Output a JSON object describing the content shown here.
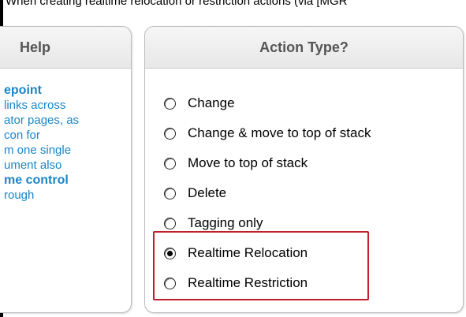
{
  "caption": "When creating realtime relocation or restriction actions  (via [MGR",
  "help_panel": {
    "title": "Help",
    "lines": [
      {
        "text": "epoint",
        "bold": true
      },
      {
        "text": " links across",
        "bold": false
      },
      {
        "text": "ator pages, as",
        "bold": false
      },
      {
        "text": "con for",
        "bold": false
      },
      {
        "text": "m one single",
        "bold": false
      },
      {
        "text": "ument also",
        "bold": false
      },
      {
        "text": "me control",
        "bold": true
      },
      {
        "text": "rough",
        "bold": false
      }
    ]
  },
  "action_panel": {
    "title": "Action Type?",
    "options": [
      {
        "label": "Change",
        "checked": false
      },
      {
        "label": "Change & move to top of stack",
        "checked": false
      },
      {
        "label": "Move to top of stack",
        "checked": false
      },
      {
        "label": "Delete",
        "checked": false
      },
      {
        "label": "Tagging only",
        "checked": false
      },
      {
        "label": "Realtime Relocation",
        "checked": true
      },
      {
        "label": "Realtime Restriction",
        "checked": false
      }
    ]
  },
  "highlight_color": "#c0202c",
  "link_color": "#1a86c8"
}
